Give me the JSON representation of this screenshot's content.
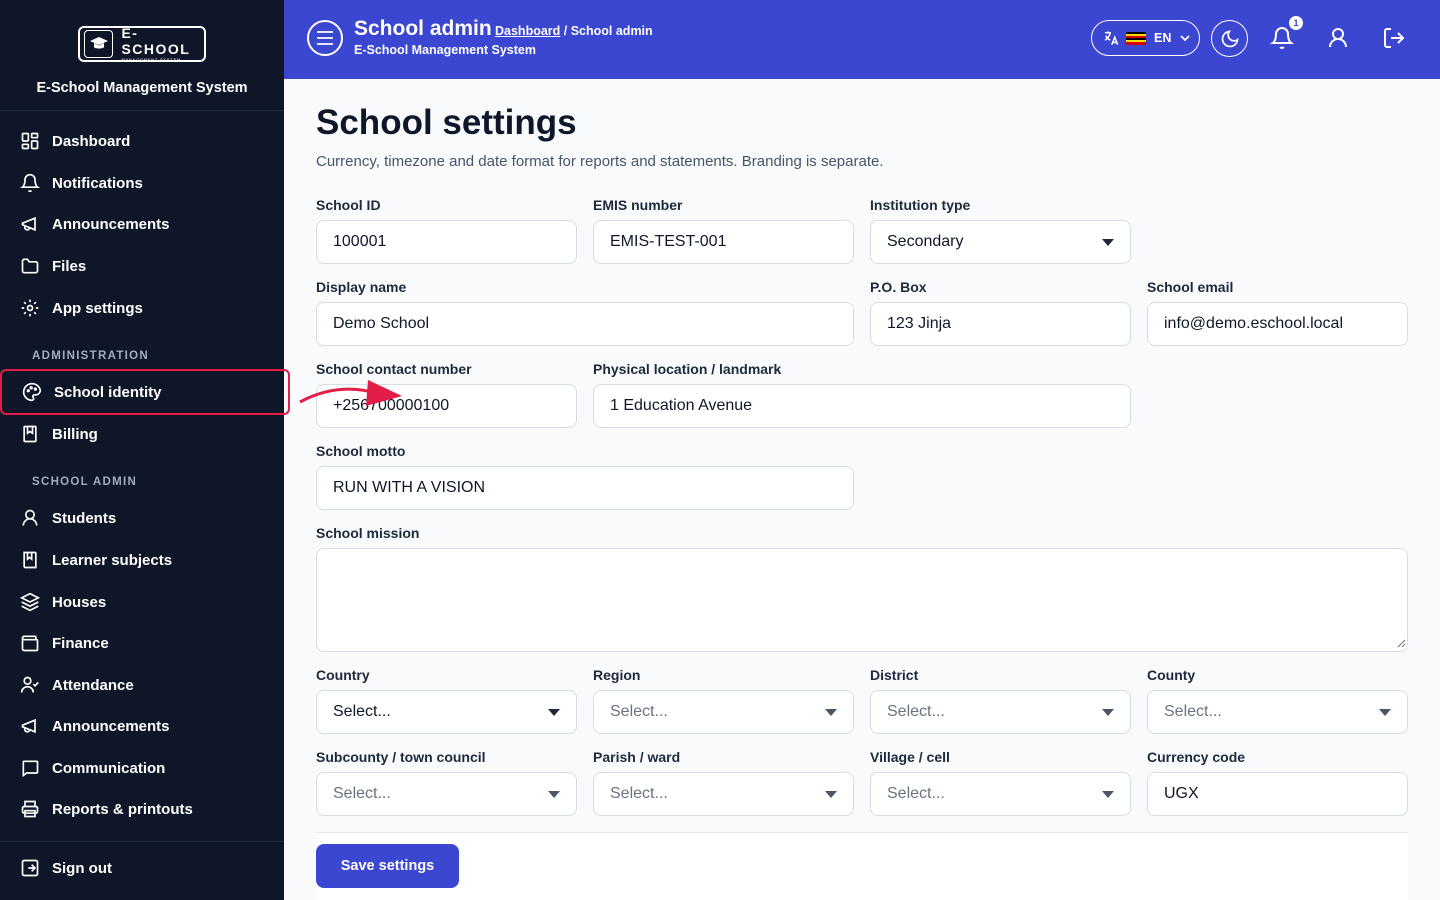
{
  "brand": {
    "logo_text": "E-SCHOOL",
    "logo_subtext": "MANAGEMENT SYSTEM",
    "name": "E-School Management System"
  },
  "sidebar": {
    "main_items": [
      {
        "label": "Dashboard",
        "icon": "grid-icon"
      },
      {
        "label": "Notifications",
        "icon": "bell-icon"
      },
      {
        "label": "Announcements",
        "icon": "megaphone-icon"
      },
      {
        "label": "Files",
        "icon": "folder-icon"
      },
      {
        "label": "App settings",
        "icon": "gear-icon"
      }
    ],
    "section_admin": "ADMINISTRATION",
    "admin_items": [
      {
        "label": "School identity",
        "icon": "palette-icon"
      },
      {
        "label": "Billing",
        "icon": "receipt-icon"
      }
    ],
    "section_school": "SCHOOL ADMIN",
    "school_items": [
      {
        "label": "Students",
        "icon": "user-icon"
      },
      {
        "label": "Learner subjects",
        "icon": "book-icon"
      },
      {
        "label": "Houses",
        "icon": "layers-icon"
      },
      {
        "label": "Finance",
        "icon": "wallet-icon"
      },
      {
        "label": "Attendance",
        "icon": "user-check-icon"
      },
      {
        "label": "Announcements",
        "icon": "megaphone-icon"
      },
      {
        "label": "Communication",
        "icon": "message-icon"
      },
      {
        "label": "Reports & printouts",
        "icon": "printer-icon"
      }
    ],
    "sign_out": "Sign out"
  },
  "header": {
    "title": "School admin",
    "breadcrumb_link": "Dashboard",
    "breadcrumb_sep": " / ",
    "breadcrumb_current": "School admin",
    "subtitle": "E-School Management System",
    "language": "EN",
    "notification_count": "1"
  },
  "page": {
    "title": "School settings",
    "description": "Currency, timezone and date format for reports and statements. Branding is separate."
  },
  "form": {
    "school_id": {
      "label": "School ID",
      "value": "100001"
    },
    "emis": {
      "label": "EMIS number",
      "value": "EMIS-TEST-001"
    },
    "institution_type": {
      "label": "Institution type",
      "value": "Secondary"
    },
    "display_name": {
      "label": "Display name",
      "value": "Demo School"
    },
    "po_box": {
      "label": "P.O. Box",
      "value": "123 Jinja"
    },
    "email": {
      "label": "School email",
      "value": "info@demo.eschool.local"
    },
    "contact": {
      "label": "School contact number",
      "value": "+256700000100"
    },
    "location": {
      "label": "Physical location / landmark",
      "value": "1 Education Avenue"
    },
    "motto": {
      "label": "School motto",
      "value": "RUN WITH A VISION"
    },
    "mission": {
      "label": "School mission",
      "value": ""
    },
    "country": {
      "label": "Country",
      "value": "Select..."
    },
    "region": {
      "label": "Region",
      "value": "Select..."
    },
    "district": {
      "label": "District",
      "value": "Select..."
    },
    "county": {
      "label": "County",
      "value": "Select..."
    },
    "subcounty": {
      "label": "Subcounty / town council",
      "value": "Select..."
    },
    "parish": {
      "label": "Parish / ward",
      "value": "Select..."
    },
    "village": {
      "label": "Village / cell",
      "value": "Select..."
    },
    "currency": {
      "label": "Currency code",
      "value": "UGX"
    }
  },
  "save_label": "Save settings",
  "colors": {
    "sidebar_bg": "#0e1628",
    "header_bg": "#3b46d1",
    "accent": "#3b46d1",
    "highlight": "#e11d48"
  }
}
